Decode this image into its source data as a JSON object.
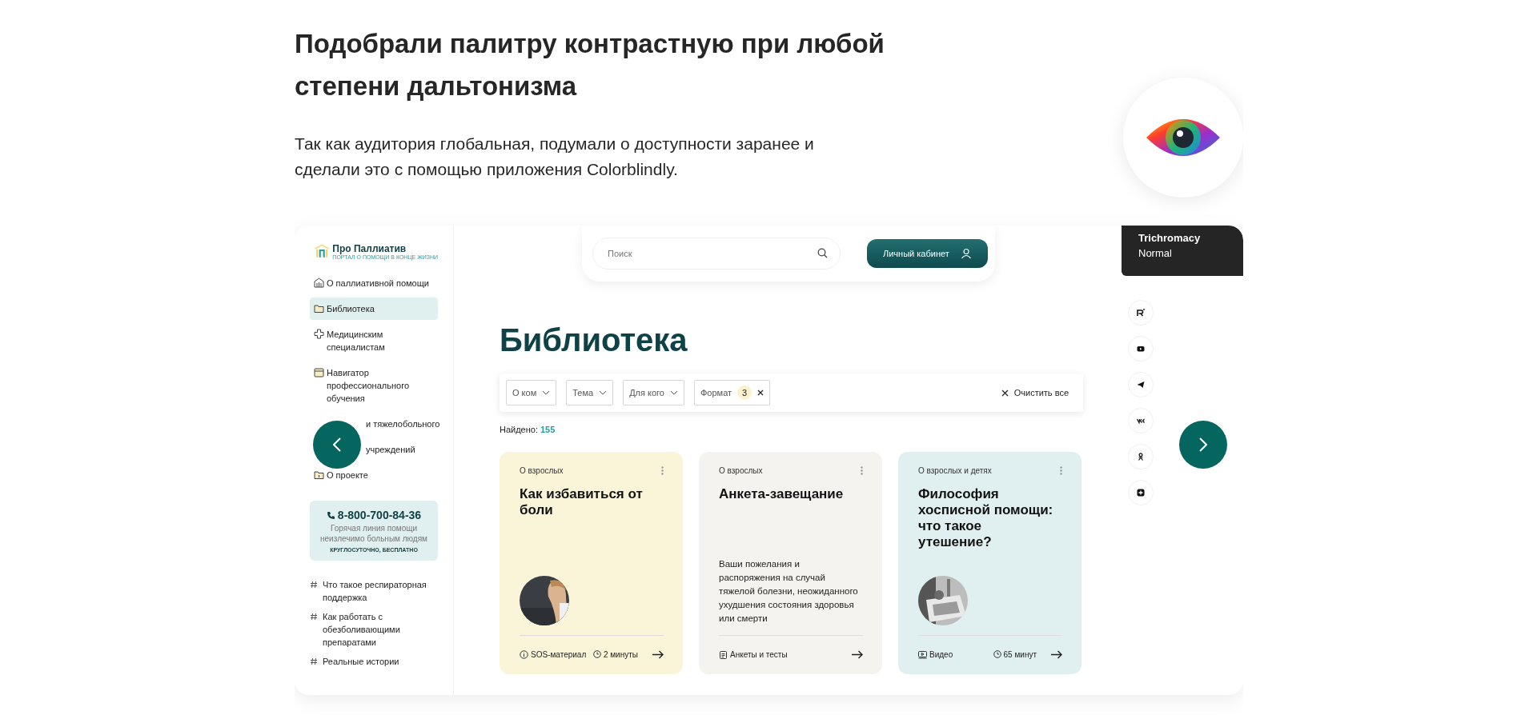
{
  "header": {
    "title": "Подобрали палитру контрастную при любой степени дальтонизма",
    "text": "Так как аудитория глобальная, подумали о доступности заранее и сделали это с помощью приложения Colorblindly."
  },
  "sidebar": {
    "logo": {
      "name": "Про Паллиатив",
      "tagline": "ПОРТАЛ О ПОМОЩИ В КОНЦЕ ЖИЗНИ"
    },
    "items": [
      {
        "kind": "building",
        "label": "О паллиативной помощи",
        "selected": false
      },
      {
        "kind": "folder",
        "label": "Библиотека",
        "selected": true
      },
      {
        "kind": "cross",
        "label": "Медицинским специалистам",
        "selected": false
      },
      {
        "kind": "calendar",
        "label": "Навигатор профессионального обучения",
        "selected": false
      },
      {
        "kind": "covered",
        "label": "и тяжелобольного",
        "selected": false
      },
      {
        "kind": "covered",
        "label": "учреждений",
        "selected": false
      },
      {
        "kind": "info",
        "label": "О проекте",
        "selected": false
      }
    ],
    "hotline": {
      "phone": "8-800-700-84-36",
      "text": "Горячая линия помощи неизлечимо больным людям",
      "note": "КРУГЛОСУТОЧНО, БЕСПЛАТНО"
    },
    "tags": [
      "Что такое респираторная поддержка",
      "Как работать с обезболивающими препаратами",
      "Реальные истории"
    ]
  },
  "topbar": {
    "search": {
      "placeholder": "Поиск"
    },
    "account_button": "Личный кабинет"
  },
  "page_title": "Библиотека",
  "filters": [
    {
      "kind": "dropdown",
      "label": "О ком"
    },
    {
      "kind": "dropdown",
      "label": "Тема"
    },
    {
      "kind": "dropdown",
      "label": "Для кого"
    },
    {
      "kind": "active",
      "label": "Формат",
      "count": "3"
    }
  ],
  "clear_button": "Очистить все",
  "found": {
    "label": "Найдено:",
    "count": "155"
  },
  "cards": [
    {
      "color": "#faf4d8",
      "category": "О взрослых",
      "title": "Как избавиться от боли",
      "type": {
        "kind": "info",
        "label": "SOS-материал"
      },
      "duration": "2 минуты"
    },
    {
      "color": "#f4f3ef",
      "category": "О взрослых",
      "title": "Анкета-завещание",
      "description": "Ваши пожелания и распоряжения на случай тяжелой болезни, неожиданного ухудшения состояния здоровья или смерти",
      "type": {
        "kind": "clipboard",
        "label": "Анкеты и тесты"
      }
    },
    {
      "color": "#e0efef",
      "category": "О взрослых и детях",
      "title": "Философия хосписной помощи: что такое утешение?",
      "type": {
        "kind": "video",
        "label": "Видео"
      },
      "duration": "65 минут"
    }
  ],
  "simulator": {
    "title": "Trichromacy",
    "mode": "Normal"
  },
  "social": [
    {
      "kind": "r"
    },
    {
      "kind": "video"
    },
    {
      "kind": "send"
    },
    {
      "kind": "vk"
    },
    {
      "kind": "ok"
    },
    {
      "kind": "plus"
    }
  ]
}
